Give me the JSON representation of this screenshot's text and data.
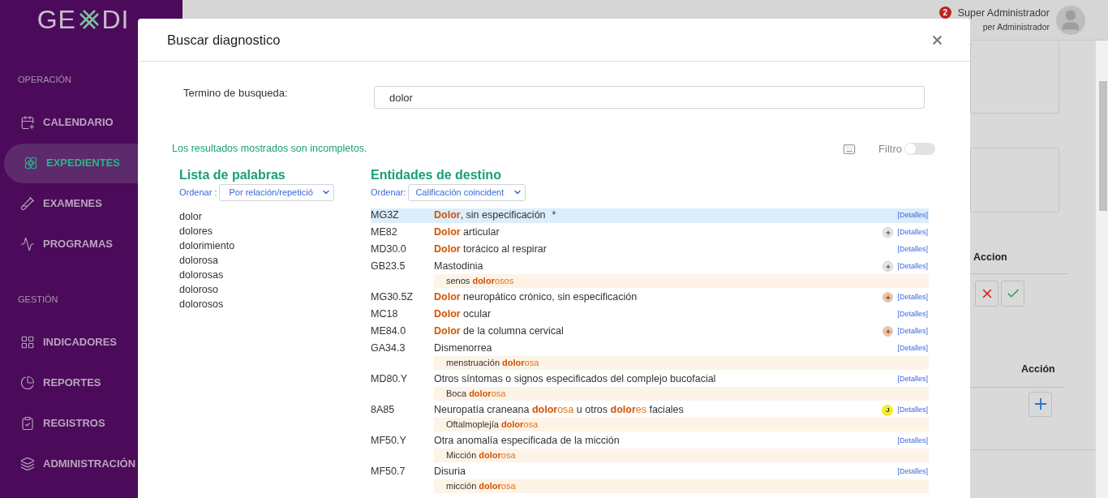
{
  "sidebar": {
    "logo": {
      "left": "GE",
      "right": "DI"
    },
    "sections": [
      {
        "title": "OPERACIÓN",
        "items": [
          {
            "label": "CALENDARIO",
            "selected": false
          },
          {
            "label": "EXPEDIENTES",
            "selected": true
          },
          {
            "label": "EXAMENES",
            "selected": false
          },
          {
            "label": "PROGRAMAS",
            "selected": false
          }
        ]
      },
      {
        "title": "GESTIÓN",
        "items": [
          {
            "label": "INDICADORES",
            "selected": false
          },
          {
            "label": "REPORTES",
            "selected": false
          },
          {
            "label": "REGISTROS",
            "selected": false
          },
          {
            "label": "ADMINISTRACIÓN",
            "selected": false
          }
        ]
      }
    ]
  },
  "header": {
    "notifications": "2",
    "user_name": "Super Administrador",
    "user_role": "per Administrador"
  },
  "background": {
    "column_1": "Accion",
    "column_2": "Acción"
  },
  "modal": {
    "title": "Buscar diagnostico",
    "search": {
      "label": "Termino de busqueda:",
      "value": "dolor"
    },
    "notice": "Los resultados mostrados son incompletos.",
    "filter": {
      "label": "Filtro",
      "on": false
    },
    "words": {
      "title": "Lista de palabras",
      "sort_label": "Ordenar :",
      "sort_value": "Por relación/repetició",
      "items": [
        "dolor",
        "dolores",
        "dolorimiento",
        "dolorosa",
        "dolorosas",
        "doloroso",
        "dolorosos"
      ]
    },
    "entities": {
      "title": "Entidades de destino",
      "sort_label": "Ordenar:",
      "sort_value": "Calificación coincident",
      "rows": [
        {
          "code": "MG3Z",
          "selected": true,
          "parts": [
            {
              "text": "Dolor",
              "kind": "match"
            },
            {
              "text": ", sin especificación",
              "kind": "plain"
            }
          ],
          "mark": "*",
          "link": "[Detalles]"
        },
        {
          "code": "ME82",
          "selected": false,
          "parts": [
            {
              "text": "Dolor",
              "kind": "match"
            },
            {
              "text": " articular",
              "kind": "plain"
            }
          ],
          "badge": {
            "kind": "plus",
            "color": "#e8e8e8"
          },
          "link": "[Detalles]"
        },
        {
          "code": "MD30.0",
          "selected": false,
          "parts": [
            {
              "text": "Dolor",
              "kind": "match"
            },
            {
              "text": " torácico al respirar",
              "kind": "plain"
            }
          ],
          "link": "[Detalles]"
        },
        {
          "code": "GB23.5",
          "selected": false,
          "parts": [
            {
              "text": "Mastodinia",
              "kind": "plain"
            }
          ],
          "badge": {
            "kind": "plus",
            "color": "#e8e8e8"
          },
          "link": "[Detalles]",
          "synonym": [
            {
              "text": "senos ",
              "kind": "plain"
            },
            {
              "text": "dolor",
              "kind": "match"
            },
            {
              "text": "osos",
              "kind": "suffix"
            }
          ]
        },
        {
          "code": "MG30.5Z",
          "selected": false,
          "parts": [
            {
              "text": "Dolor",
              "kind": "match"
            },
            {
              "text": " neuropático crónico, sin especificación",
              "kind": "plain"
            }
          ],
          "badge": {
            "kind": "plus",
            "color": "#f8c29c"
          },
          "link": "[Detalles]"
        },
        {
          "code": "MC18",
          "selected": false,
          "parts": [
            {
              "text": "Dolor",
              "kind": "match"
            },
            {
              "text": " ocular",
              "kind": "plain"
            }
          ],
          "link": "[Detalles]"
        },
        {
          "code": "ME84.0",
          "selected": false,
          "parts": [
            {
              "text": "Dolor",
              "kind": "match"
            },
            {
              "text": " de la columna cervical",
              "kind": "plain"
            }
          ],
          "badge": {
            "kind": "plus",
            "color": "#f8c29c"
          },
          "link": "[Detalles]"
        },
        {
          "code": "GA34.3",
          "selected": false,
          "parts": [
            {
              "text": "Dismenorrea",
              "kind": "plain"
            }
          ],
          "link": "[Detalles]",
          "synonym": [
            {
              "text": "menstruación ",
              "kind": "plain"
            },
            {
              "text": "dolor",
              "kind": "match"
            },
            {
              "text": "osa",
              "kind": "suffix"
            }
          ]
        },
        {
          "code": "MD80.Y",
          "selected": false,
          "parts": [
            {
              "text": "Otros síntomas o signos especificados del complejo bucofacial",
              "kind": "plain"
            }
          ],
          "link": "[Detalles]",
          "synonym": [
            {
              "text": "Boca ",
              "kind": "plain"
            },
            {
              "text": "dolor",
              "kind": "match"
            },
            {
              "text": "osa",
              "kind": "suffix"
            }
          ]
        },
        {
          "code": "8A85",
          "selected": false,
          "parts": [
            {
              "text": "Neuropatía craneana ",
              "kind": "plain"
            },
            {
              "text": "dolor",
              "kind": "match"
            },
            {
              "text": "osa",
              "kind": "suffix"
            },
            {
              "text": " u otros ",
              "kind": "plain"
            },
            {
              "text": "dolor",
              "kind": "match"
            },
            {
              "text": "es",
              "kind": "suffix"
            },
            {
              "text": " faciales",
              "kind": "plain"
            }
          ],
          "badge": {
            "kind": "letter",
            "text": "J",
            "color": "#f2ec2e"
          },
          "link": "[Detalles]",
          "synonym": [
            {
              "text": "Oftalmoplejía ",
              "kind": "plain"
            },
            {
              "text": "dolor",
              "kind": "match"
            },
            {
              "text": "osa",
              "kind": "suffix"
            }
          ]
        },
        {
          "code": "MF50.Y",
          "selected": false,
          "parts": [
            {
              "text": "Otra anomalía especificada de la micción",
              "kind": "plain"
            }
          ],
          "link": "[Detalles]",
          "synonym": [
            {
              "text": "Micción ",
              "kind": "plain"
            },
            {
              "text": "dolor",
              "kind": "match"
            },
            {
              "text": "osa",
              "kind": "suffix"
            }
          ]
        },
        {
          "code": "MF50.7",
          "selected": false,
          "parts": [
            {
              "text": "Disuria",
              "kind": "plain"
            }
          ],
          "link": "[Detalles]",
          "synonym": [
            {
              "text": "micción ",
              "kind": "plain"
            },
            {
              "text": "dolor",
              "kind": "match"
            },
            {
              "text": "osa",
              "kind": "suffix"
            }
          ]
        }
      ]
    }
  }
}
